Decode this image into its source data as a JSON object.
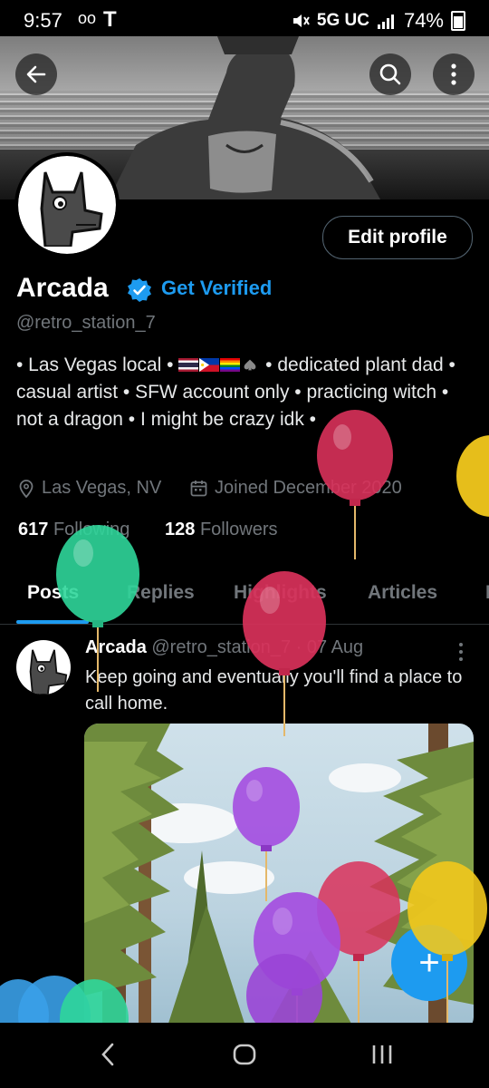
{
  "status_bar": {
    "time": "9:57",
    "voicemail_icon": "oo",
    "carrier_logo": "T",
    "mute_icon": "mute-icon",
    "network": "5G UC",
    "battery": "74%"
  },
  "header": {
    "back_icon": "arrow-left-icon",
    "search_icon": "search-icon",
    "more_icon": "more-vertical-icon"
  },
  "profile": {
    "name": "Arcada",
    "get_verified": "Get Verified",
    "handle": "@retro_station_7",
    "edit_profile": "Edit profile",
    "bio_part1": "• Las Vegas local •",
    "bio_part2": "• dedicated plant dad • casual artist • SFW account only • practicing witch • not a dragon • I might be crazy idk •",
    "location": "Las Vegas, NV",
    "joined": "Joined December 2020",
    "following_count": "617",
    "following_label": "Following",
    "followers_count": "128",
    "followers_label": "Followers"
  },
  "tabs": {
    "posts": "Posts",
    "replies": "Replies",
    "highlights": "Highlights",
    "articles": "Articles",
    "media": "M"
  },
  "post": {
    "author": "Arcada",
    "handle": "@retro_station_7",
    "date": "· 07 Aug",
    "text": "Keep going and eventually you'll find a place to call home."
  },
  "fab": {
    "label": "+"
  },
  "colors": {
    "accent": "#1d9bf0",
    "background": "#000000",
    "muted": "#71767b",
    "balloon_red": "#d9315a",
    "balloon_green": "#2fd69a",
    "balloon_purple": "#a44de0",
    "balloon_yellow": "#f2c81c",
    "balloon_blue": "#3aa0e8"
  }
}
